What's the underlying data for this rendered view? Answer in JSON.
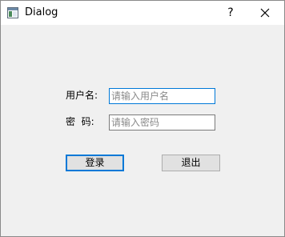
{
  "window": {
    "title": "Dialog",
    "help_label": "?"
  },
  "icons": {
    "app": "app-window-icon",
    "close": "close-icon"
  },
  "form": {
    "username_label": "用户名:",
    "username_placeholder": "请输入用户名",
    "password_label": "密  码:",
    "password_placeholder": "请输入密码"
  },
  "buttons": {
    "login_label": "登录",
    "exit_label": "退出"
  },
  "colors": {
    "accent": "#0078d7",
    "window_bg": "#f0f0f0",
    "titlebar_bg": "#ffffff"
  }
}
